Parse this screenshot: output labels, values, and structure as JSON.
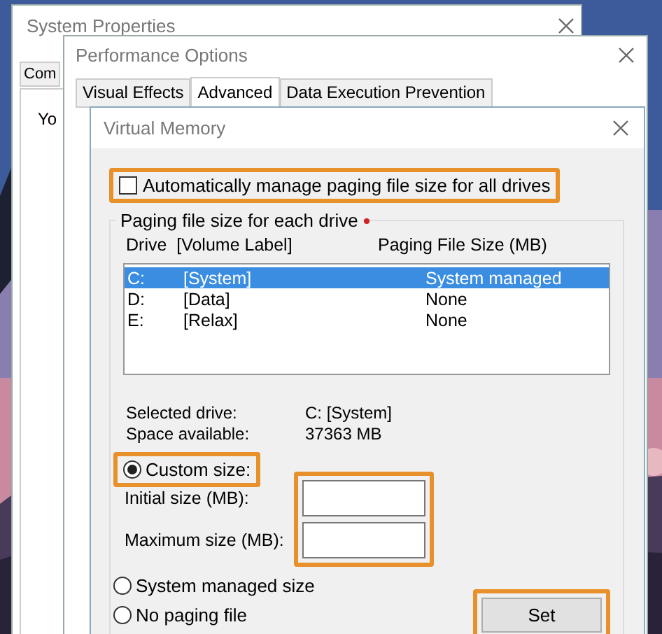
{
  "system_properties": {
    "title": "System Properties",
    "tab": "Com",
    "text": "Yo"
  },
  "performance_options": {
    "title": "Performance Options",
    "tabs": [
      {
        "label": "Visual Effects",
        "selected": false
      },
      {
        "label": "Advanced",
        "selected": true
      },
      {
        "label": "Data Execution Prevention",
        "selected": false
      }
    ]
  },
  "virtual_memory": {
    "title": "Virtual Memory",
    "auto_manage": {
      "label": "Automatically manage paging file size for all drives",
      "checked": false,
      "highlighted": true
    },
    "group_title": "Paging file size for each drive",
    "columns": [
      "Drive  [Volume Label]",
      "Paging File Size (MB)"
    ],
    "drives": [
      {
        "drive": "C:",
        "label": "[System]",
        "size": "System managed",
        "selected": true
      },
      {
        "drive": "D:",
        "label": "[Data]",
        "size": "None",
        "selected": false
      },
      {
        "drive": "E:",
        "label": "[Relax]",
        "size": "None",
        "selected": false
      }
    ],
    "info": [
      {
        "label": "Selected drive:",
        "value": "C:  [System]"
      },
      {
        "label": "Space available:",
        "value": "37363 MB"
      }
    ],
    "options": [
      {
        "label": "Custom size:",
        "selected": true,
        "highlighted": true
      },
      {
        "label": "System managed size",
        "selected": false,
        "highlighted": false
      },
      {
        "label": "No paging file",
        "selected": false,
        "highlighted": false
      }
    ],
    "fields": [
      {
        "label": "Initial size (MB):"
      },
      {
        "label": "Maximum size (MB):"
      }
    ],
    "fields_highlighted": true,
    "set_button": {
      "label": "Set",
      "highlighted": true
    }
  }
}
